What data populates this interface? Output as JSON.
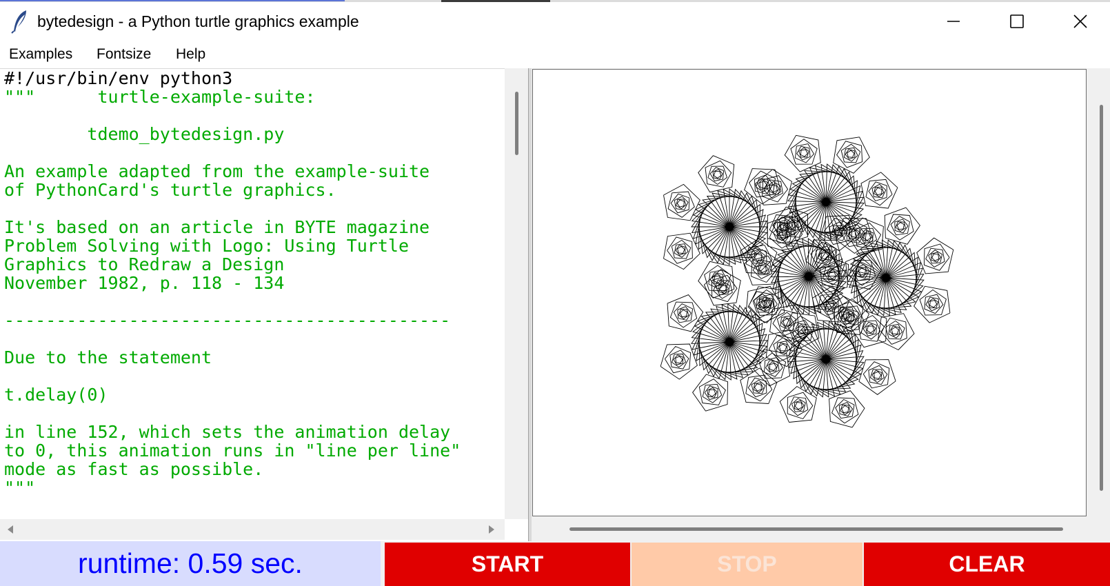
{
  "window": {
    "title": "bytedesign - a Python turtle graphics example",
    "icon": "feather-icon"
  },
  "menu": {
    "items": [
      {
        "label": "Examples"
      },
      {
        "label": "Fontsize"
      },
      {
        "label": "Help"
      }
    ]
  },
  "editor": {
    "shebang": "#!/usr/bin/env python3",
    "docstring": "\"\"\"      turtle-example-suite:\n\n        tdemo_bytedesign.py\n\nAn example adapted from the example-suite\nof PythonCard's turtle graphics.\n\nIt's based on an article in BYTE magazine\nProblem Solving with Logo: Using Turtle\nGraphics to Redraw a Design\nNovember 1982, p. 118 - 134\n\n-------------------------------------------\n\nDue to the statement\n\nt.delay(0)\n\nin line 152, which sets the animation delay\nto 0, this animation runs in \"line per line\"\nmode as fast as possible.\n\"\"\""
  },
  "footer": {
    "runtime": "runtime: 0.59 sec.",
    "start_label": "START",
    "stop_label": "STOP",
    "clear_label": "CLEAR"
  },
  "colors": {
    "code_green": "#00aa00",
    "button_red": "#e00000",
    "stop_disabled": "#ffcaa8",
    "runtime_bg": "#d8dcfe",
    "runtime_text": "#0000ff"
  }
}
